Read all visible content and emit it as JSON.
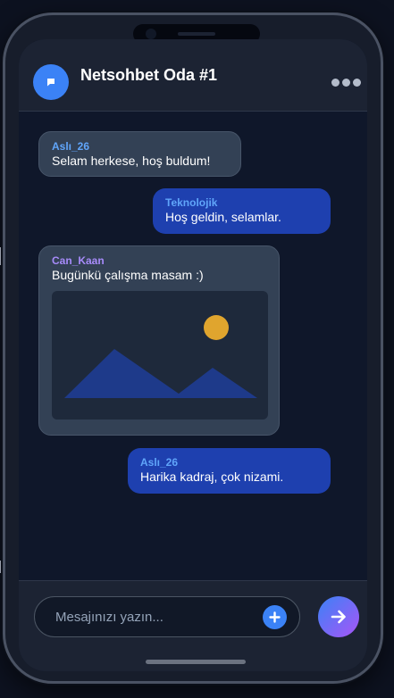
{
  "chat": {
    "title": "Netsohbet Oda #1",
    "avatar_icon": "chat-icon",
    "menu_icon": "more-options-icon"
  },
  "messages": [
    {
      "sender": "Aslı_26",
      "sender_color": "#60a5fa",
      "text": "Selam herkese, hoş buldum!",
      "direction": "incoming"
    },
    {
      "sender": "Teknolojik",
      "sender_color": "#60a5fa",
      "text": "Hoş geldin, selamlar.",
      "direction": "outgoing"
    },
    {
      "sender": "Can_Kaan",
      "sender_color": "#a78bfa",
      "text": "Bugünkü çalışma masam :)",
      "direction": "incoming",
      "attachment": "image-placeholder"
    },
    {
      "sender": "Aslı_26",
      "sender_color": "#60a5fa",
      "text": "Harika kadraj, çok nizami.",
      "direction": "outgoing"
    }
  ],
  "composer": {
    "placeholder": "Mesajınızı yazın...",
    "add_icon": "plus-icon",
    "send_icon": "arrow-right-icon"
  },
  "colors": {
    "accent": "#3b82f6",
    "outgoing_bubble": "#1e40af",
    "incoming_bubble": "#334155",
    "background": "#0f172a",
    "send_gradient_end": "#a855f7"
  }
}
